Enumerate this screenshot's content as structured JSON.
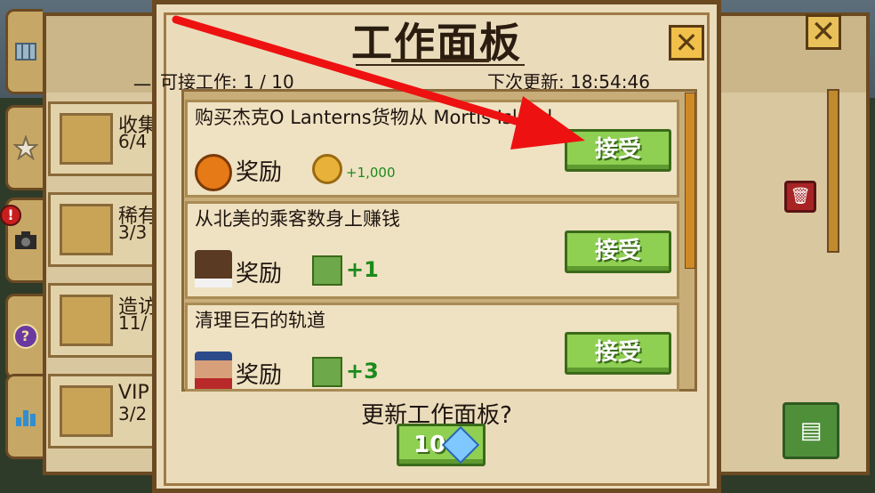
{
  "background": {
    "left_cards": [
      {
        "title": "收集",
        "count": "6/4"
      },
      {
        "title": "稀有",
        "count": "3/3"
      },
      {
        "title": "造访",
        "count": "11/"
      },
      {
        "title": "VIP",
        "count": "3/2"
      }
    ],
    "underlay_text": "一",
    "colors": {
      "tab": "#c7a765",
      "panel": "#d9c7a0"
    }
  },
  "dialog": {
    "title": "工作面板",
    "close_icon": "x-icon",
    "jobs_available_label": "可接工作: 1 / 10",
    "next_refresh_label": "下次更新: 18:54:46",
    "jobs": [
      {
        "title": "购买杰克O Lanterns货物从 Mortis Island",
        "reward_label": "奖励",
        "reward_icon": "pumpkin-icon",
        "value_icon": "coin-icon",
        "reward_value": "+1,000",
        "accept_label": "接受"
      },
      {
        "title": "从北美的乘客数身上赚钱",
        "reward_label": "奖励",
        "reward_icon": "passenger-avatar-icon",
        "value_icon": "vip-upgrade-icon",
        "reward_value": "+1",
        "accept_label": "接受"
      },
      {
        "title": "清理巨石的轨道",
        "reward_label": "奖励",
        "reward_icon": "worker-avatar-icon",
        "value_icon": "vip-upgrade-icon",
        "reward_value": "+3",
        "accept_label": "接受"
      }
    ],
    "refresh_prompt": "更新工作面板?",
    "refresh_cost": "10",
    "refresh_currency_icon": "gem-icon"
  },
  "accent_colors": {
    "accept_green": "#8fcf52",
    "reward_green": "#1c8a1c",
    "arrow_red": "#ee1111"
  }
}
